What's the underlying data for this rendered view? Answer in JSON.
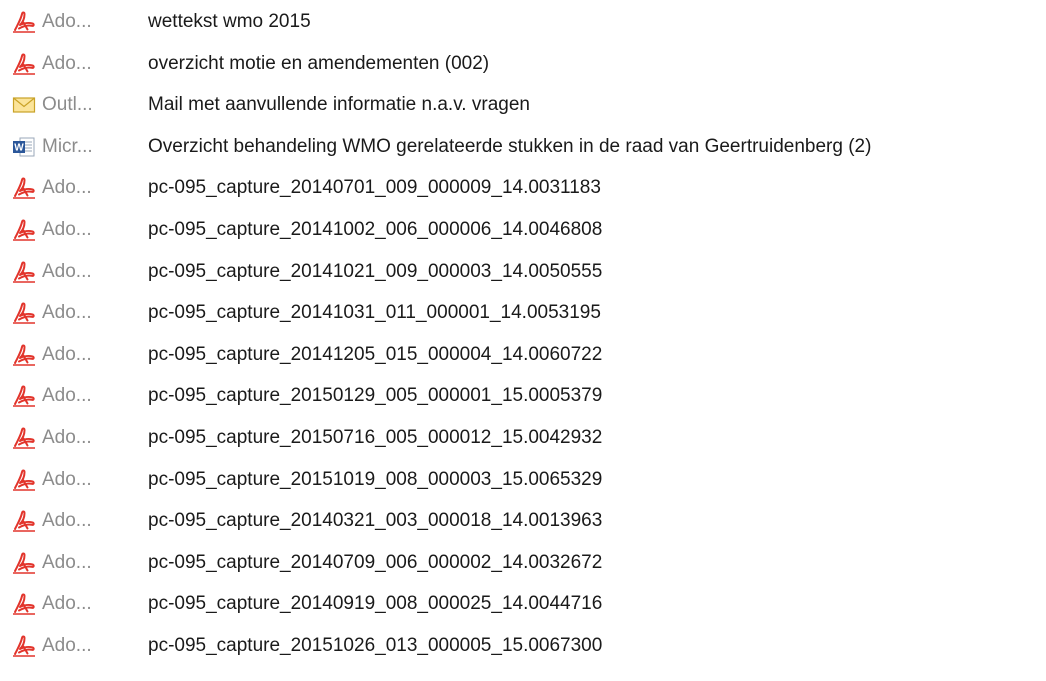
{
  "files": [
    {
      "icon": "pdf-icon",
      "type": "Ado...",
      "name": "wettekst  wmo 2015"
    },
    {
      "icon": "pdf-icon",
      "type": "Ado...",
      "name": "overzicht motie en amendementen (002)"
    },
    {
      "icon": "mail-icon",
      "type": "Outl...",
      "name": "Mail met aanvullende informatie n.a.v. vragen"
    },
    {
      "icon": "word-icon",
      "type": "Micr...",
      "name": "Overzicht behandeling WMO gerelateerde stukken in de raad van Geertruidenberg (2)"
    },
    {
      "icon": "pdf-icon",
      "type": "Ado...",
      "name": "pc-095_capture_20140701_009_000009_14.0031183"
    },
    {
      "icon": "pdf-icon",
      "type": "Ado...",
      "name": "pc-095_capture_20141002_006_000006_14.0046808"
    },
    {
      "icon": "pdf-icon",
      "type": "Ado...",
      "name": "pc-095_capture_20141021_009_000003_14.0050555"
    },
    {
      "icon": "pdf-icon",
      "type": "Ado...",
      "name": "pc-095_capture_20141031_011_000001_14.0053195"
    },
    {
      "icon": "pdf-icon",
      "type": "Ado...",
      "name": "pc-095_capture_20141205_015_000004_14.0060722"
    },
    {
      "icon": "pdf-icon",
      "type": "Ado...",
      "name": "pc-095_capture_20150129_005_000001_15.0005379"
    },
    {
      "icon": "pdf-icon",
      "type": "Ado...",
      "name": "pc-095_capture_20150716_005_000012_15.0042932"
    },
    {
      "icon": "pdf-icon",
      "type": "Ado...",
      "name": "pc-095_capture_20151019_008_000003_15.0065329"
    },
    {
      "icon": "pdf-icon",
      "type": "Ado...",
      "name": "pc-095_capture_20140321_003_000018_14.0013963"
    },
    {
      "icon": "pdf-icon",
      "type": "Ado...",
      "name": "pc-095_capture_20140709_006_000002_14.0032672"
    },
    {
      "icon": "pdf-icon",
      "type": "Ado...",
      "name": "pc-095_capture_20140919_008_000025_14.0044716"
    },
    {
      "icon": "pdf-icon",
      "type": "Ado...",
      "name": "pc-095_capture_20151026_013_000005_15.0067300"
    }
  ],
  "colors": {
    "pdf": "#e2342b",
    "mail_fill": "#fbe49a",
    "mail_stroke": "#c9a227",
    "word": "#2b579a",
    "type_text": "#8c8c8c",
    "name_text": "#1a1a1a"
  }
}
